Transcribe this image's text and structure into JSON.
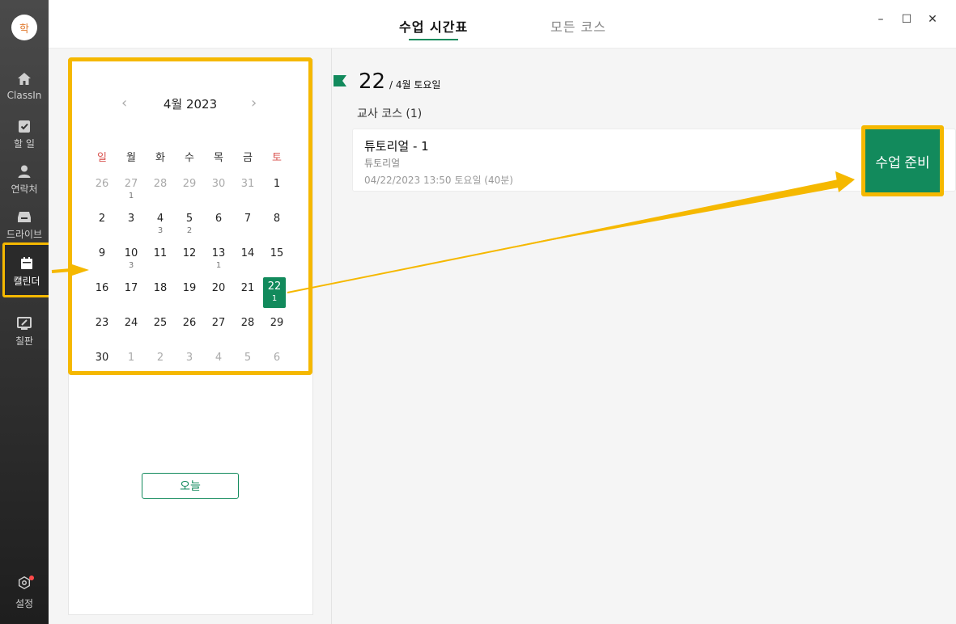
{
  "sidebar": {
    "avatar": "학",
    "items": [
      {
        "label": "ClassIn",
        "icon": "home-icon"
      },
      {
        "label": "할 일",
        "icon": "checklist-icon"
      },
      {
        "label": "연락처",
        "icon": "person-icon"
      },
      {
        "label": "드라이브",
        "icon": "drive-icon"
      },
      {
        "label": "캘린더",
        "icon": "calendar-icon"
      },
      {
        "label": "칠판",
        "icon": "blackboard-icon"
      }
    ],
    "settings": {
      "label": "설정",
      "icon": "settings-icon"
    }
  },
  "topbar": {
    "tabs": [
      {
        "label": "수업 시간표"
      },
      {
        "label": "모든 코스"
      }
    ],
    "window": {
      "minimize": "–",
      "maximize": "☐",
      "close": "✕"
    }
  },
  "calendar": {
    "prev": "‹",
    "next": "›",
    "title": "4월 2023",
    "weekdays": [
      "일",
      "월",
      "화",
      "수",
      "목",
      "금",
      "토"
    ],
    "weeks": [
      [
        {
          "d": "26",
          "c": ""
        },
        {
          "d": "27",
          "c": "1"
        },
        {
          "d": "28",
          "c": ""
        },
        {
          "d": "29",
          "c": ""
        },
        {
          "d": "30",
          "c": ""
        },
        {
          "d": "31",
          "c": ""
        },
        {
          "d": "1",
          "c": ""
        }
      ],
      [
        {
          "d": "2",
          "c": ""
        },
        {
          "d": "3",
          "c": ""
        },
        {
          "d": "4",
          "c": "3"
        },
        {
          "d": "5",
          "c": "2"
        },
        {
          "d": "6",
          "c": ""
        },
        {
          "d": "7",
          "c": ""
        },
        {
          "d": "8",
          "c": ""
        }
      ],
      [
        {
          "d": "9",
          "c": ""
        },
        {
          "d": "10",
          "c": "3"
        },
        {
          "d": "11",
          "c": ""
        },
        {
          "d": "12",
          "c": ""
        },
        {
          "d": "13",
          "c": "1"
        },
        {
          "d": "14",
          "c": ""
        },
        {
          "d": "15",
          "c": ""
        }
      ],
      [
        {
          "d": "16",
          "c": ""
        },
        {
          "d": "17",
          "c": ""
        },
        {
          "d": "18",
          "c": ""
        },
        {
          "d": "19",
          "c": ""
        },
        {
          "d": "20",
          "c": ""
        },
        {
          "d": "21",
          "c": ""
        },
        {
          "d": "22",
          "c": "1"
        }
      ],
      [
        {
          "d": "23",
          "c": ""
        },
        {
          "d": "24",
          "c": ""
        },
        {
          "d": "25",
          "c": ""
        },
        {
          "d": "26",
          "c": ""
        },
        {
          "d": "27",
          "c": ""
        },
        {
          "d": "28",
          "c": ""
        },
        {
          "d": "29",
          "c": ""
        }
      ],
      [
        {
          "d": "30",
          "c": ""
        },
        {
          "d": "1",
          "c": ""
        },
        {
          "d": "2",
          "c": ""
        },
        {
          "d": "3",
          "c": ""
        },
        {
          "d": "4",
          "c": ""
        },
        {
          "d": "5",
          "c": ""
        },
        {
          "d": "6",
          "c": ""
        }
      ]
    ],
    "today_label": "오늘"
  },
  "schedule": {
    "day": "22",
    "date_sub": "/ 4월 토요일",
    "section": "교사 코스 (1)",
    "course": {
      "title": "튜토리얼 - 1",
      "subtitle": "튜토리얼",
      "time": "04/22/2023 13:50 토요일 (40분)",
      "action": "수업 준비"
    }
  },
  "colors": {
    "accent": "#128a5c",
    "highlight": "#f5b800"
  }
}
